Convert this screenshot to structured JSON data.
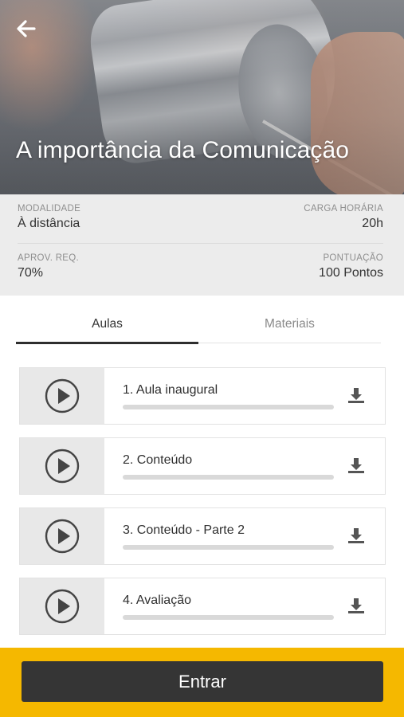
{
  "header": {
    "title": "A importância da Comunicação",
    "back_icon": "arrow-left-icon"
  },
  "info": {
    "modalidade": {
      "label": "MODALIDADE",
      "value": "À distância"
    },
    "carga_horaria": {
      "label": "CARGA HORÁRIA",
      "value": "20h"
    },
    "aprov_req": {
      "label": "APROV. REQ.",
      "value": "70%"
    },
    "pontuacao": {
      "label": "PONTUAÇÃO",
      "value": "100 Pontos"
    }
  },
  "tabs": [
    {
      "label": "Aulas",
      "active": true
    },
    {
      "label": "Materiais",
      "active": false
    }
  ],
  "lessons": [
    {
      "title": "1. Aula inaugural",
      "progress": 0,
      "icon": "play-circle-icon",
      "action_icon": "download-icon"
    },
    {
      "title": "2. Conteúdo",
      "progress": 0,
      "icon": "play-circle-icon",
      "action_icon": "download-icon"
    },
    {
      "title": "3. Conteúdo - Parte 2",
      "progress": 0,
      "icon": "play-circle-icon",
      "action_icon": "download-icon"
    },
    {
      "title": "4. Avaliação",
      "progress": 0,
      "icon": "play-circle-icon",
      "action_icon": "download-icon"
    }
  ],
  "footer": {
    "enter_label": "Entrar"
  },
  "colors": {
    "accent": "#f5b800",
    "button": "#353535",
    "info_bg": "#ececec"
  }
}
